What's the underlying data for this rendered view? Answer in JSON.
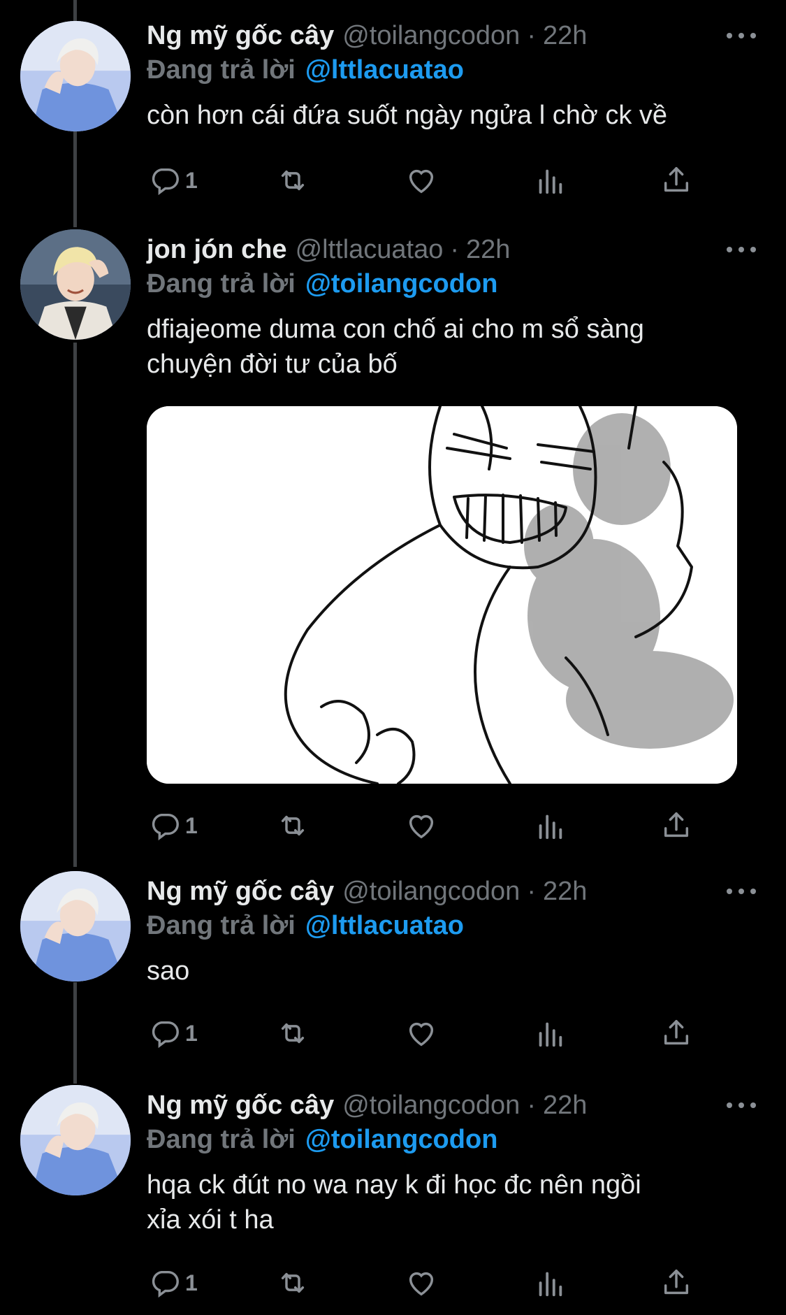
{
  "colors": {
    "background": "#000000",
    "text": "#e7e9ea",
    "muted": "#71767b",
    "link": "#1d9bf0",
    "thread_line": "#3e4144"
  },
  "reply_prefix": "Đang trả lời",
  "tweets": [
    {
      "name": "Ng mỹ gốc cây",
      "handle": "@toilangcodon",
      "separator": "·",
      "time": "22h",
      "reply_to": "@lttlacuatao",
      "text": "còn hơn cái đứa suốt ngày ngửa l chờ ck về",
      "reply_count": "1",
      "avatar": "avatar-blonde-blue-shirt",
      "has_media": false
    },
    {
      "name": "jon jón che",
      "handle": "@lttlacuatao",
      "separator": "·",
      "time": "22h",
      "reply_to": "@toilangcodon",
      "text_lines": [
        "dfiajeome duma con chố ai cho m sổ sàng",
        "chuyện đời tư của bố"
      ],
      "reply_count": "1",
      "avatar": "avatar-blonde-smiling",
      "has_media": true,
      "media": "anime-sketch-image"
    },
    {
      "name": "Ng mỹ gốc cây",
      "handle": "@toilangcodon",
      "separator": "·",
      "time": "22h",
      "reply_to": "@lttlacuatao",
      "text": "sao",
      "reply_count": "1",
      "avatar": "avatar-blonde-blue-shirt",
      "has_media": false
    },
    {
      "name": "Ng mỹ gốc cây",
      "handle": "@toilangcodon",
      "separator": "·",
      "time": "22h",
      "reply_to": "@toilangcodon",
      "text_lines": [
        "hqa ck đút no wa nay k đi học đc nên ngồi",
        "xỉa xói t ha"
      ],
      "reply_count": "1",
      "avatar": "avatar-blonde-blue-shirt",
      "has_media": false
    }
  ],
  "icons": [
    "reply-icon",
    "retweet-icon",
    "like-icon",
    "analytics-icon",
    "share-icon",
    "more-icon"
  ]
}
